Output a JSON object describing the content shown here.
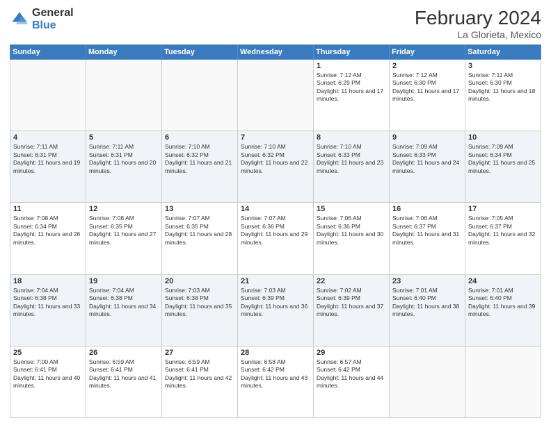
{
  "header": {
    "logo_general": "General",
    "logo_blue": "Blue",
    "month_year": "February 2024",
    "location": "La Glorieta, Mexico"
  },
  "days_of_week": [
    "Sunday",
    "Monday",
    "Tuesday",
    "Wednesday",
    "Thursday",
    "Friday",
    "Saturday"
  ],
  "weeks": [
    [
      {
        "day": "",
        "info": ""
      },
      {
        "day": "",
        "info": ""
      },
      {
        "day": "",
        "info": ""
      },
      {
        "day": "",
        "info": ""
      },
      {
        "day": "1",
        "info": "Sunrise: 7:12 AM\nSunset: 6:29 PM\nDaylight: 11 hours and 17 minutes."
      },
      {
        "day": "2",
        "info": "Sunrise: 7:12 AM\nSunset: 6:30 PM\nDaylight: 11 hours and 17 minutes."
      },
      {
        "day": "3",
        "info": "Sunrise: 7:11 AM\nSunset: 6:30 PM\nDaylight: 11 hours and 18 minutes."
      }
    ],
    [
      {
        "day": "4",
        "info": "Sunrise: 7:11 AM\nSunset: 6:31 PM\nDaylight: 11 hours and 19 minutes."
      },
      {
        "day": "5",
        "info": "Sunrise: 7:11 AM\nSunset: 6:31 PM\nDaylight: 11 hours and 20 minutes."
      },
      {
        "day": "6",
        "info": "Sunrise: 7:10 AM\nSunset: 6:32 PM\nDaylight: 11 hours and 21 minutes."
      },
      {
        "day": "7",
        "info": "Sunrise: 7:10 AM\nSunset: 6:32 PM\nDaylight: 11 hours and 22 minutes."
      },
      {
        "day": "8",
        "info": "Sunrise: 7:10 AM\nSunset: 6:33 PM\nDaylight: 11 hours and 23 minutes."
      },
      {
        "day": "9",
        "info": "Sunrise: 7:09 AM\nSunset: 6:33 PM\nDaylight: 11 hours and 24 minutes."
      },
      {
        "day": "10",
        "info": "Sunrise: 7:09 AM\nSunset: 6:34 PM\nDaylight: 11 hours and 25 minutes."
      }
    ],
    [
      {
        "day": "11",
        "info": "Sunrise: 7:08 AM\nSunset: 6:34 PM\nDaylight: 11 hours and 26 minutes."
      },
      {
        "day": "12",
        "info": "Sunrise: 7:08 AM\nSunset: 6:35 PM\nDaylight: 11 hours and 27 minutes."
      },
      {
        "day": "13",
        "info": "Sunrise: 7:07 AM\nSunset: 6:35 PM\nDaylight: 11 hours and 28 minutes."
      },
      {
        "day": "14",
        "info": "Sunrise: 7:07 AM\nSunset: 6:36 PM\nDaylight: 11 hours and 29 minutes."
      },
      {
        "day": "15",
        "info": "Sunrise: 7:06 AM\nSunset: 6:36 PM\nDaylight: 11 hours and 30 minutes."
      },
      {
        "day": "16",
        "info": "Sunrise: 7:06 AM\nSunset: 6:37 PM\nDaylight: 11 hours and 31 minutes."
      },
      {
        "day": "17",
        "info": "Sunrise: 7:05 AM\nSunset: 6:37 PM\nDaylight: 11 hours and 32 minutes."
      }
    ],
    [
      {
        "day": "18",
        "info": "Sunrise: 7:04 AM\nSunset: 6:38 PM\nDaylight: 11 hours and 33 minutes."
      },
      {
        "day": "19",
        "info": "Sunrise: 7:04 AM\nSunset: 6:38 PM\nDaylight: 11 hours and 34 minutes."
      },
      {
        "day": "20",
        "info": "Sunrise: 7:03 AM\nSunset: 6:38 PM\nDaylight: 11 hours and 35 minutes."
      },
      {
        "day": "21",
        "info": "Sunrise: 7:03 AM\nSunset: 6:39 PM\nDaylight: 11 hours and 36 minutes."
      },
      {
        "day": "22",
        "info": "Sunrise: 7:02 AM\nSunset: 6:39 PM\nDaylight: 11 hours and 37 minutes."
      },
      {
        "day": "23",
        "info": "Sunrise: 7:01 AM\nSunset: 6:40 PM\nDaylight: 11 hours and 38 minutes."
      },
      {
        "day": "24",
        "info": "Sunrise: 7:01 AM\nSunset: 6:40 PM\nDaylight: 11 hours and 39 minutes."
      }
    ],
    [
      {
        "day": "25",
        "info": "Sunrise: 7:00 AM\nSunset: 6:41 PM\nDaylight: 11 hours and 40 minutes."
      },
      {
        "day": "26",
        "info": "Sunrise: 6:59 AM\nSunset: 6:41 PM\nDaylight: 11 hours and 41 minutes."
      },
      {
        "day": "27",
        "info": "Sunrise: 6:59 AM\nSunset: 6:41 PM\nDaylight: 11 hours and 42 minutes."
      },
      {
        "day": "28",
        "info": "Sunrise: 6:58 AM\nSunset: 6:42 PM\nDaylight: 11 hours and 43 minutes."
      },
      {
        "day": "29",
        "info": "Sunrise: 6:57 AM\nSunset: 6:42 PM\nDaylight: 11 hours and 44 minutes."
      },
      {
        "day": "",
        "info": ""
      },
      {
        "day": "",
        "info": ""
      }
    ]
  ]
}
